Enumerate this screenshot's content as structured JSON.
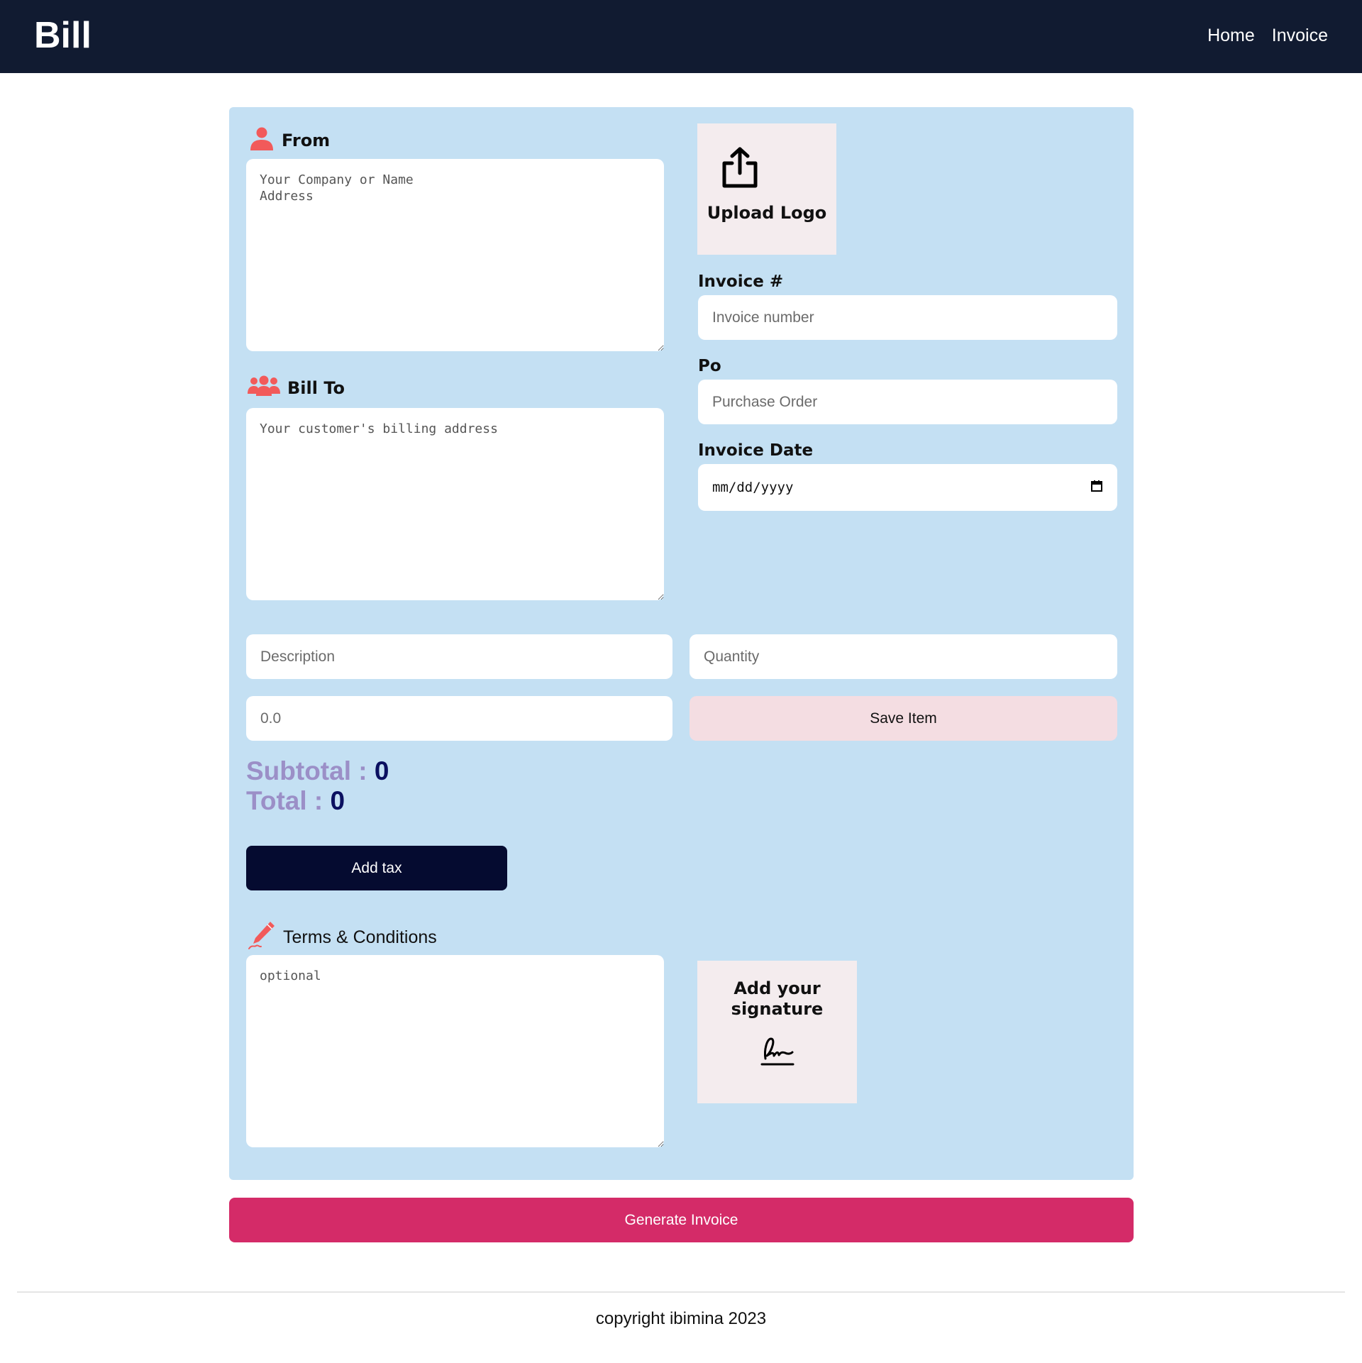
{
  "header": {
    "brand": "Bill",
    "nav": [
      "Home",
      "Invoice"
    ]
  },
  "from": {
    "label": "From",
    "placeholder": "Your Company or Name\nAddress",
    "icon": "person-icon"
  },
  "bill_to": {
    "label": "Bill To",
    "placeholder": "Your customer's billing address",
    "icon": "group-icon"
  },
  "upload_logo": {
    "label": "Upload Logo",
    "icon": "upload-icon"
  },
  "invoice_number": {
    "label": "Invoice #",
    "placeholder": "Invoice number"
  },
  "po": {
    "label": "Po",
    "placeholder": "Purchase Order"
  },
  "invoice_date": {
    "label": "Invoice Date",
    "value": "mm/dd/yyyy",
    "icon": "calendar-icon"
  },
  "item": {
    "description_placeholder": "Description",
    "quantity_placeholder": "Quantity",
    "price_placeholder": "0.0",
    "save_label": "Save Item"
  },
  "totals": {
    "subtotal_label": "Subtotal : ",
    "subtotal_value": "0",
    "total_label": "Total : ",
    "total_value": "0"
  },
  "tax_button": "Add tax",
  "terms": {
    "label": "Terms & Conditions",
    "placeholder": "optional",
    "icon": "pen-icon"
  },
  "signature": {
    "label": "Add your signature",
    "icon": "signature-icon"
  },
  "generate_button": "Generate Invoice",
  "footer": "copyright ibimina 2023",
  "colors": {
    "header_bg": "#111b31",
    "card_bg": "#c4e0f3",
    "accent_red": "#f25a5a",
    "generate_bg": "#d42b68",
    "tax_bg": "#050b30",
    "save_bg": "#f4dde2"
  }
}
